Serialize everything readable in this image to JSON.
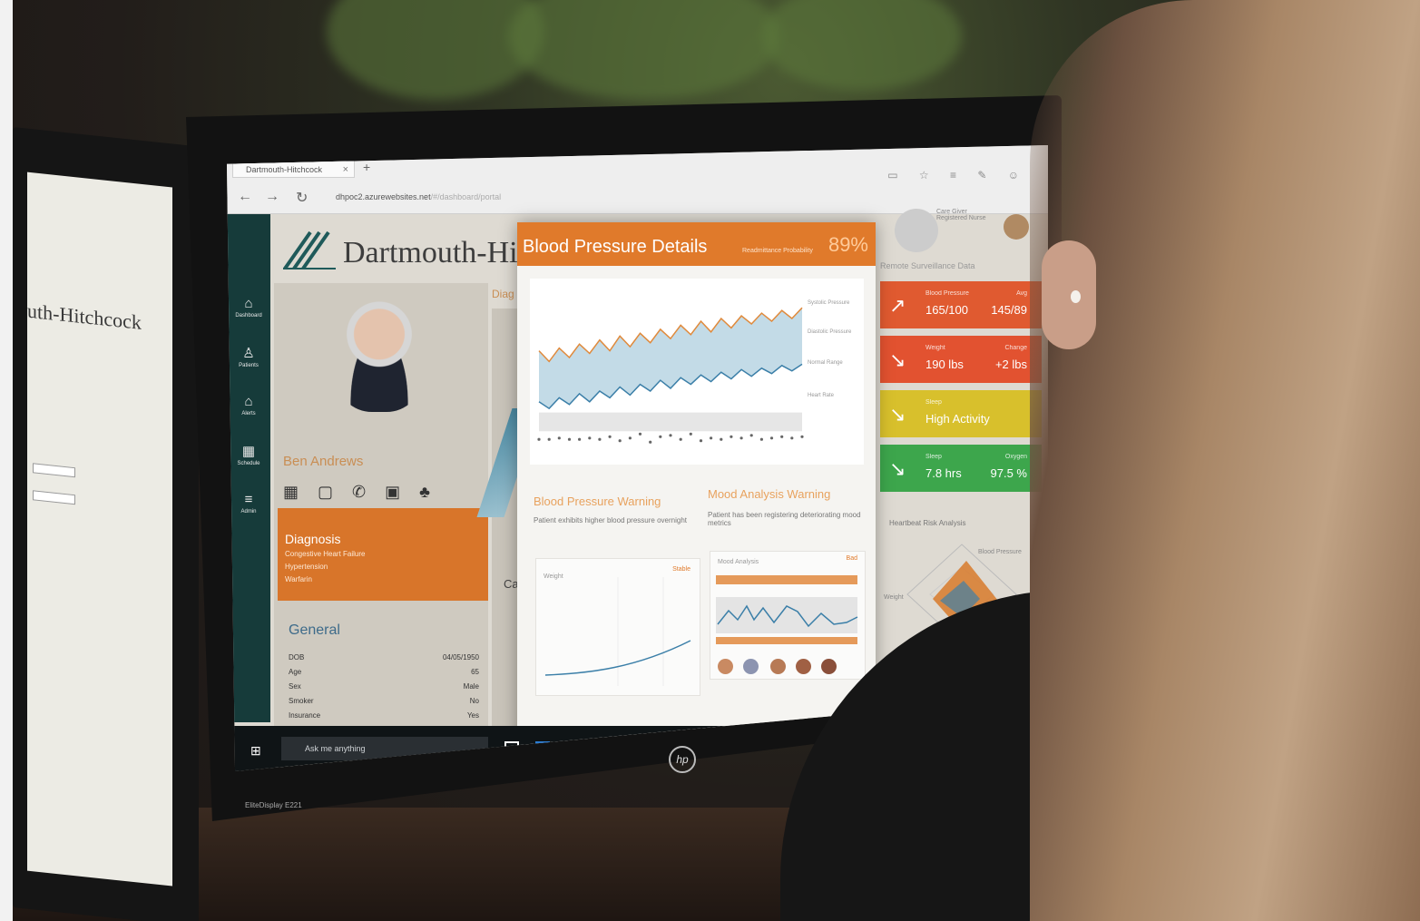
{
  "browser": {
    "tab_title": "Dartmouth-Hitchcock",
    "tab_close": "×",
    "new_tab": "+",
    "back": "←",
    "forward": "→",
    "refresh": "↻",
    "url_host": "dhpoc2.azurewebsites.net",
    "url_path": "/#/dashboard/portal",
    "toolbar_icons": "▭ ☆ ≡ ✎ ☺"
  },
  "left_monitor": {
    "logo_text": "uth-Hitchcock"
  },
  "app": {
    "brand": "Dartmouth-Hitchcock",
    "nav": [
      {
        "icon": "⌂",
        "label": "Dashboard"
      },
      {
        "icon": "♙",
        "label": "Patients"
      },
      {
        "icon": "⌂",
        "label": "Alerts"
      },
      {
        "icon": "▦",
        "label": "Schedule"
      },
      {
        "icon": "≡",
        "label": "Admin"
      }
    ],
    "patient": {
      "name": "Ben Andrews",
      "contact_icons": "▦ ▢ ✆ ▣ ♣",
      "diagnosis_title": "Diagnosis",
      "diagnoses": [
        "Congestive Heart Failure",
        "Hypertension",
        "Warfarin"
      ],
      "general_title": "General",
      "general": [
        {
          "label": "DOB",
          "value": "04/05/1950"
        },
        {
          "label": "Age",
          "value": "65"
        },
        {
          "label": "Sex",
          "value": "Male"
        },
        {
          "label": "Smoker",
          "value": "No"
        },
        {
          "label": "Insurance",
          "value": "Yes"
        }
      ]
    },
    "middle": {
      "diag_tab": "Diag",
      "cal_tab": "Ca"
    },
    "modal": {
      "title": "Blood Pressure Details",
      "prob_label": "Readmittance Probability",
      "prob_value": "89%",
      "legend": [
        "Systolic Pressure",
        "Diastolic Pressure",
        "Normal Range",
        "Heart Rate"
      ],
      "bp_warning_title": "Blood Pressure Warning",
      "bp_warning_text": "Patient exhibits higher blood pressure overnight",
      "mood_warning_title": "Mood Analysis Warning",
      "mood_warning_text": "Patient has been registering deteriorating mood metrics",
      "weight_label": "Weight",
      "weight_status": "Stable",
      "mood_label": "Mood Analysis",
      "mood_status": "Bad"
    },
    "right": {
      "section_title": "Remote Surveillance Data",
      "profile_line1": "Care Giver",
      "profile_line2": "Registered Nurse",
      "stats": [
        {
          "label": "Blood Pressure",
          "value": "165/100",
          "label2": "Avg",
          "value2": "145/89",
          "color": "#e05a30",
          "arrow": "↗"
        },
        {
          "label": "Weight",
          "value": "190 lbs",
          "label2": "Change",
          "value2": "+2 lbs",
          "color": "#e25230",
          "arrow": "↘"
        },
        {
          "label": "Sleep",
          "value": "High Activity",
          "label2": "",
          "value2": "",
          "color": "#d8c02c",
          "arrow": "↘"
        },
        {
          "label": "Sleep",
          "value": "7.8 hrs",
          "label2": "Oxygen",
          "value2": "97.5 %",
          "color": "#3da64c",
          "arrow": "↘"
        }
      ],
      "radar_title": "Heartbeat Risk Analysis",
      "radar_label_top": "Blood Pressure",
      "radar_label_left": "Weight"
    },
    "taskbar": {
      "search": "Ask me anything"
    }
  },
  "monitor": {
    "brand": "hp",
    "model": "EliteDisplay E221"
  },
  "chart_data": {
    "type": "line",
    "x": [
      1,
      2,
      3,
      4,
      5,
      6,
      7,
      8,
      9,
      10,
      11,
      12,
      13,
      14,
      15,
      16,
      17,
      18,
      19,
      20,
      21,
      22,
      23,
      24,
      25,
      26,
      27
    ],
    "series": [
      {
        "name": "Systolic Pressure",
        "values": [
          138,
          130,
          140,
          133,
          143,
          136,
          146,
          138,
          149,
          141,
          151,
          144,
          154,
          147,
          157,
          150,
          160,
          152,
          162,
          155,
          164,
          158,
          166,
          160,
          168,
          162,
          170
        ]
      },
      {
        "name": "Diastolic Pressure",
        "values": [
          100,
          95,
          103,
          98,
          106,
          100,
          108,
          103,
          111,
          105,
          113,
          108,
          116,
          110,
          118,
          113,
          120,
          115,
          122,
          117,
          124,
          119,
          125,
          121,
          127,
          123,
          128
        ]
      },
      {
        "name": "Heart Rate",
        "values": [
          72,
          72,
          73,
          72,
          72,
          73,
          72,
          74,
          71,
          73,
          76,
          70,
          74,
          75,
          72,
          76,
          71,
          73,
          72,
          74,
          73,
          75,
          72,
          73,
          74,
          73,
          74
        ]
      }
    ],
    "normal_range": [
      78,
      92
    ],
    "ylim": [
      60,
      185
    ]
  }
}
